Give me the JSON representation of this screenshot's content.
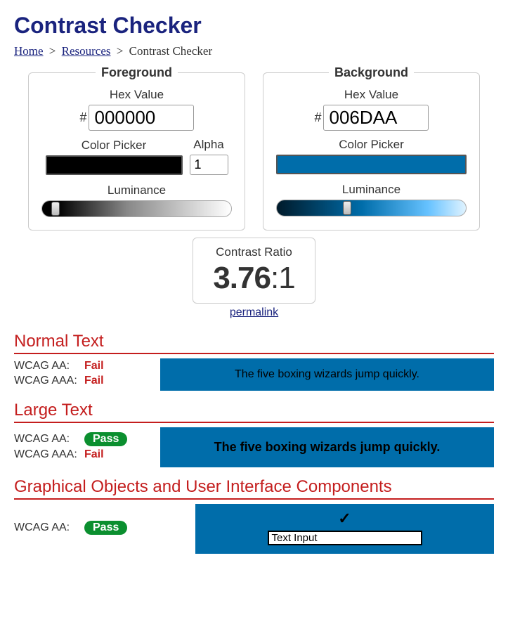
{
  "title": "Contrast Checker",
  "breadcrumb": {
    "home": "Home",
    "resources": "Resources",
    "current": "Contrast Checker"
  },
  "fg": {
    "title": "Foreground",
    "hex_label": "Hex Value",
    "hex": "000000",
    "picker_label": "Color Picker",
    "alpha_label": "Alpha",
    "alpha": "1",
    "lum_label": "Luminance",
    "swatch_color": "#000000",
    "thumb_pct": 5
  },
  "bg": {
    "title": "Background",
    "hex_label": "Hex Value",
    "hex": "006DAA",
    "picker_label": "Color Picker",
    "lum_label": "Luminance",
    "swatch_color": "#006DAA",
    "thumb_pct": 35
  },
  "ratio": {
    "label": "Contrast Ratio",
    "value": "3.76",
    "suffix": ":1",
    "permalink": "permalink"
  },
  "sections": {
    "normal": {
      "heading": "Normal Text",
      "aa_label": "WCAG AA:",
      "aa_result": "Fail",
      "aaa_label": "WCAG AAA:",
      "aaa_result": "Fail",
      "sample": "The five boxing wizards jump quickly."
    },
    "large": {
      "heading": "Large Text",
      "aa_label": "WCAG AA:",
      "aa_result": "Pass",
      "aaa_label": "WCAG AAA:",
      "aaa_result": "Fail",
      "sample": "The five boxing wizards jump quickly."
    },
    "gfx": {
      "heading": "Graphical Objects and User Interface Components",
      "aa_label": "WCAG AA:",
      "aa_result": "Pass",
      "input_sample": "Text Input"
    }
  }
}
